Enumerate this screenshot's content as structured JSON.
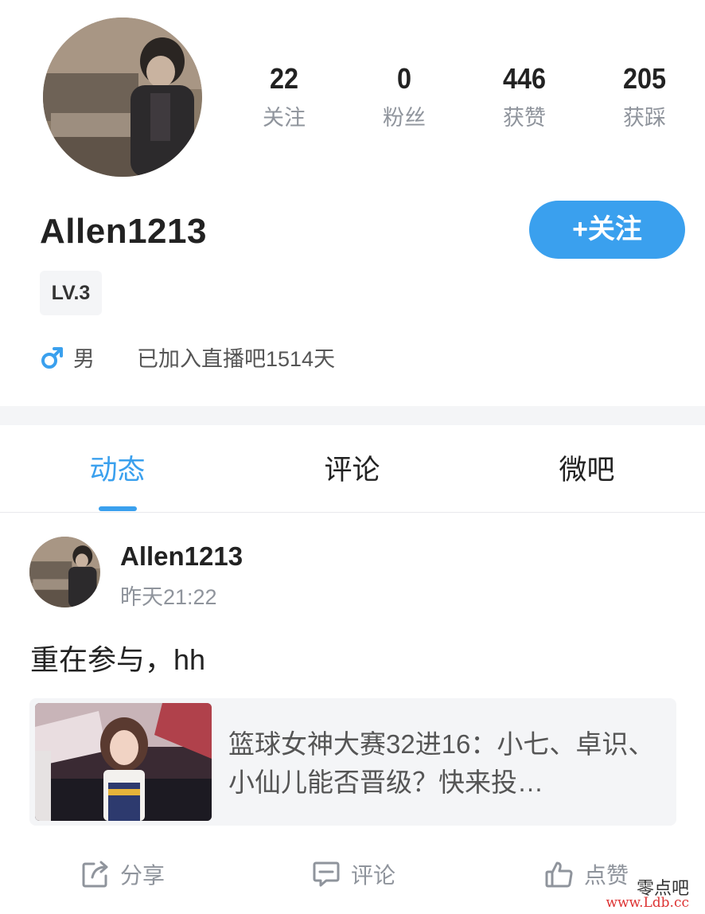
{
  "profile": {
    "username": "Allen1213",
    "level": "LV.3",
    "gender_text": "男",
    "joined_text": "已加入直播吧1514天",
    "follow_button": "+关注",
    "stats": [
      {
        "value": "22",
        "label": "关注"
      },
      {
        "value": "0",
        "label": "粉丝"
      },
      {
        "value": "446",
        "label": "获赞"
      },
      {
        "value": "205",
        "label": "获踩"
      }
    ]
  },
  "tabs": [
    {
      "label": "动态",
      "active": true
    },
    {
      "label": "评论",
      "active": false
    },
    {
      "label": "微吧",
      "active": false
    }
  ],
  "post": {
    "author": "Allen1213",
    "time": "昨天21:22",
    "text": "重在参与，hh",
    "link_card": {
      "title": "篮球女神大赛32进16：小七、卓识、小仙儿能否晋级？快来投…"
    },
    "actions": {
      "share": "分享",
      "comment": "评论",
      "like": "点赞"
    }
  },
  "watermark": {
    "line1": "零点吧",
    "line2": "www.Ldb.cc"
  },
  "colors": {
    "accent": "#3aa0ee",
    "muted_text": "#8f949c",
    "band": "#f4f5f7"
  }
}
